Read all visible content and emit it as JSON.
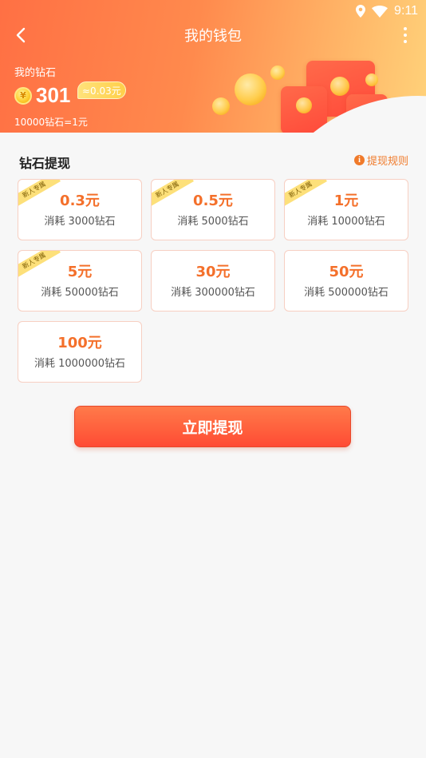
{
  "status_bar": {
    "time": "9:11"
  },
  "nav": {
    "title": "我的钱包"
  },
  "wallet": {
    "label": "我的钻石",
    "balance": "301",
    "equivalent": "≈0.03元",
    "rate": "10000钻石=1元",
    "coin_symbol": "¥"
  },
  "section": {
    "title": "钻石提现",
    "rules_label": "提现规则",
    "rules_icon": "info-icon"
  },
  "options": [
    {
      "amount": "0.3元",
      "cost": "消耗 3000钻石",
      "badge": "新人专属"
    },
    {
      "amount": "0.5元",
      "cost": "消耗 5000钻石",
      "badge": "新人专属"
    },
    {
      "amount": "1元",
      "cost": "消耗 10000钻石",
      "badge": "新人专属"
    },
    {
      "amount": "5元",
      "cost": "消耗 50000钻石",
      "badge": "新人专属"
    },
    {
      "amount": "30元",
      "cost": "消耗 300000钻石",
      "badge": ""
    },
    {
      "amount": "50元",
      "cost": "消耗 500000钻石",
      "badge": ""
    },
    {
      "amount": "100元",
      "cost": "消耗 1000000钻石",
      "badge": ""
    }
  ],
  "action": {
    "withdraw_label": "立即提现"
  },
  "colors": {
    "accent": "#f4702b",
    "header_start": "#ff7044",
    "header_end": "#ffd27a",
    "button": "#ff5a3a"
  }
}
